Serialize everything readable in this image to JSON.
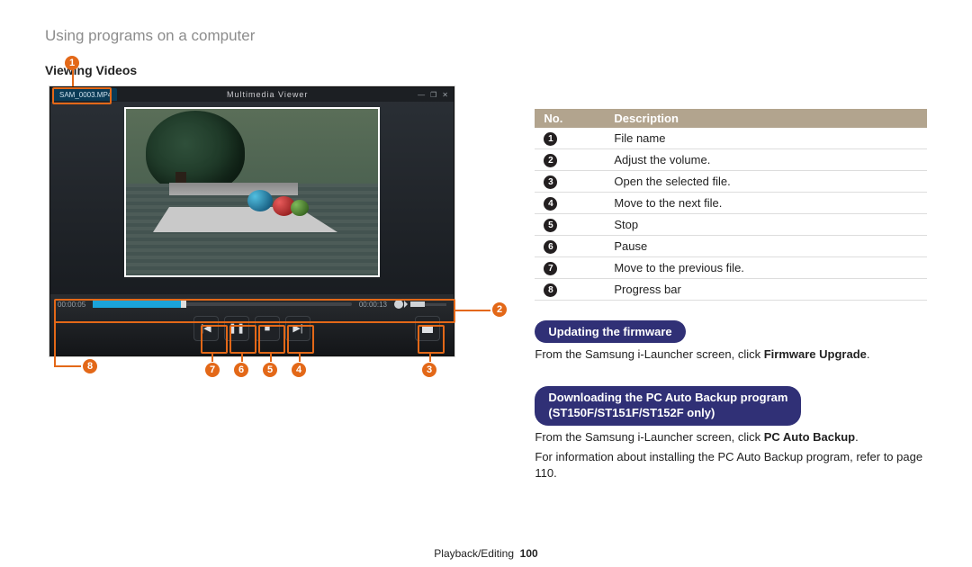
{
  "section_title": "Using programs on a computer",
  "subheading": "Viewing Videos",
  "viewer": {
    "filename": "SAM_0003.MP4",
    "window_title": "Multimedia Viewer",
    "window_icons": {
      "min": "—",
      "grow": "❐",
      "close": "✕"
    },
    "time": {
      "elapsed": "00:00:05",
      "total": "00:00:13"
    }
  },
  "callouts": {
    "c1": "1",
    "c2": "2",
    "c3": "3",
    "c4": "4",
    "c5": "5",
    "c6": "6",
    "c7": "7",
    "c8": "8"
  },
  "table": {
    "headers": {
      "no": "No.",
      "desc": "Description"
    },
    "rows": [
      {
        "n": "1",
        "d": "File name"
      },
      {
        "n": "2",
        "d": "Adjust the volume."
      },
      {
        "n": "3",
        "d": "Open the selected file."
      },
      {
        "n": "4",
        "d": "Move to the next file."
      },
      {
        "n": "5",
        "d": "Stop"
      },
      {
        "n": "6",
        "d": "Pause"
      },
      {
        "n": "7",
        "d": "Move to the previous file."
      },
      {
        "n": "8",
        "d": "Progress bar"
      }
    ]
  },
  "firmware": {
    "pill": "Updating the firmware",
    "line_a": "From the Samsung i-Launcher screen, click ",
    "line_b_bold": "Firmware Upgrade",
    "line_c": "."
  },
  "backup": {
    "pill_l1": "Downloading the PC Auto Backup program ",
    "pill_l2": "(ST150F/ST151F/ST152F only)",
    "line_a": "From the Samsung i-Launcher screen, click ",
    "line_b_bold": "PC Auto Backup",
    "line_c": ".",
    "line2": "For information about installing the PC Auto Backup program, refer to page 110."
  },
  "footer": {
    "category": "Playback/Editing",
    "page": "100"
  }
}
